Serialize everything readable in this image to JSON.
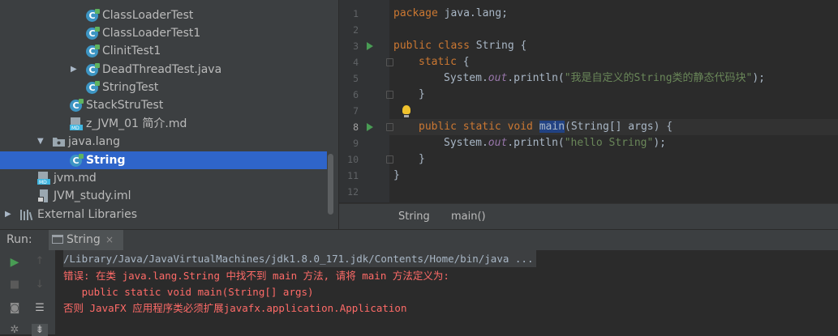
{
  "project_tree": {
    "items": [
      {
        "label": "ClassLoaderTest",
        "icon": "java-class-icon"
      },
      {
        "label": "ClassLoaderTest1",
        "icon": "java-class-icon"
      },
      {
        "label": "ClinitTest1",
        "icon": "java-class-icon"
      },
      {
        "label": "DeadThreadTest.java",
        "icon": "java-class-icon"
      },
      {
        "label": "StringTest",
        "icon": "java-class-icon"
      },
      {
        "label": "StackStruTest",
        "icon": "java-class-icon"
      },
      {
        "label": "z_JVM_01 简介.md",
        "icon": "markdown-file-icon"
      },
      {
        "label": "java.lang",
        "icon": "package-icon"
      },
      {
        "label": "String",
        "icon": "java-class-icon"
      },
      {
        "label": "jvm.md",
        "icon": "markdown-file-icon"
      },
      {
        "label": "JVM_study.iml",
        "icon": "iml-file-icon"
      },
      {
        "label": "External Libraries",
        "icon": "libraries-icon"
      }
    ]
  },
  "editor": {
    "line_numbers": [
      "1",
      "2",
      "3",
      "4",
      "5",
      "6",
      "7",
      "8",
      "9",
      "10",
      "11",
      "12"
    ],
    "code": {
      "l1_kw": "package",
      "l1_rest": " java.lang;",
      "l3_kw": "public class",
      "l3_rest": " String {",
      "l4_kw": "static",
      "l4_rest": " {",
      "l5_pre": "System.",
      "l5_fld": "out",
      "l5_mid": ".println(",
      "l5_str": "\"我是自定义的String类的静态代码块\"",
      "l5_end": ");",
      "l6": "}",
      "l8_kw": "public static void",
      "l8_sp": " ",
      "l8_hl": "main",
      "l8_rest": "(String[] args) {",
      "l9_pre": "System.",
      "l9_fld": "out",
      "l9_mid": ".println(",
      "l9_str": "\"hello String\"",
      "l9_end": ");",
      "l10": "}",
      "l11": "}"
    },
    "breadcrumb": [
      "String",
      "main()"
    ]
  },
  "run_panel": {
    "label": "Run:",
    "tab_label": "String",
    "tab_close": "×",
    "output": [
      "/Library/Java/JavaVirtualMachines/jdk1.8.0_171.jdk/Contents/Home/bin/java ...",
      "错误: 在类 java.lang.String 中找不到 main 方法, 请将 main 方法定义为:",
      "   public static void main(String[] args)",
      "否则 JavaFX 应用程序类必须扩展javafx.application.Application"
    ]
  },
  "colors": {
    "selection": "#2f65ca",
    "error": "#ff6b68",
    "keyword": "#cc7832",
    "string": "#6a8759",
    "run_green": "#499c54"
  }
}
